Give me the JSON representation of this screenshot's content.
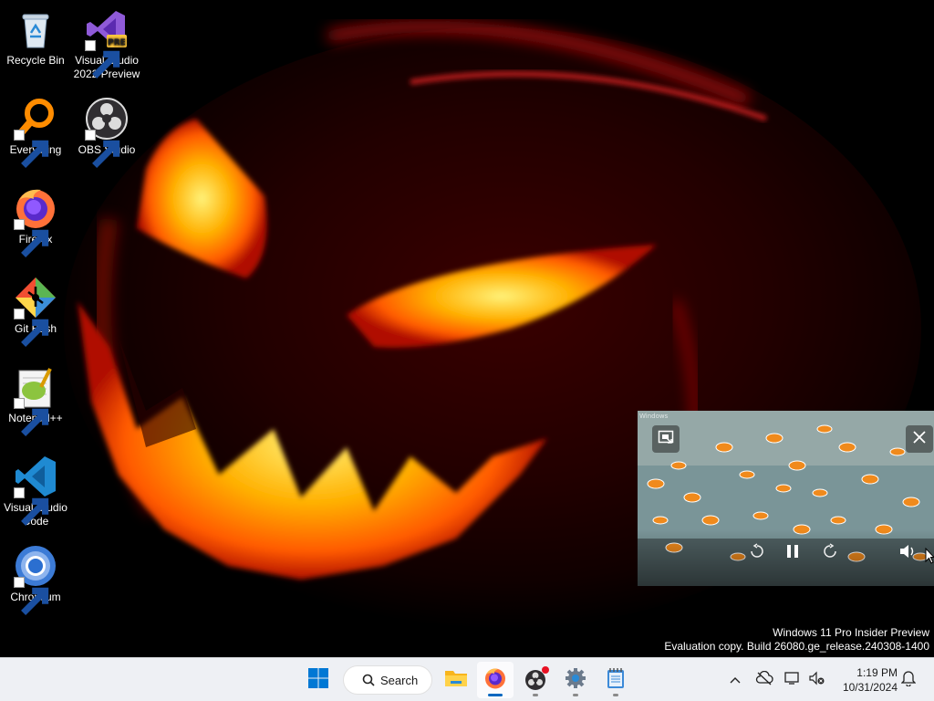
{
  "desktop": {
    "icons": [
      {
        "label": "Recycle Bin",
        "icon": "recycle-bin-icon",
        "shortcut": false
      },
      {
        "label": "Visual Studio 2022 Preview",
        "icon": "visual-studio-preview-icon",
        "shortcut": true,
        "badge": "PRE"
      },
      {
        "label": "Everything",
        "icon": "everything-search-icon",
        "shortcut": true
      },
      {
        "label": "OBS Studio",
        "icon": "obs-studio-icon",
        "shortcut": true
      },
      {
        "label": "Firefox",
        "icon": "firefox-icon",
        "shortcut": true
      },
      {
        "label": "Git Bash",
        "icon": "git-bash-icon",
        "shortcut": true
      },
      {
        "label": "Notepad++",
        "icon": "notepad-plus-plus-icon",
        "shortcut": true
      },
      {
        "label": "Visual Studio Code",
        "icon": "vscode-icon",
        "shortcut": true
      },
      {
        "label": "Chromium",
        "icon": "chromium-icon",
        "shortcut": true
      }
    ]
  },
  "watermark": {
    "line1": "Windows 11 Pro Insider Preview",
    "line2": "Evaluation copy. Build 26080.ge_release.240308-1400"
  },
  "pip_player": {
    "source_tag": "Windows",
    "controls": [
      "back-to-tab-icon",
      "close-icon",
      "rewind-10-icon",
      "pause-icon",
      "forward-10-icon",
      "volume-icon"
    ]
  },
  "taskbar": {
    "start_icon": "windows-start-icon",
    "search_label": "Search",
    "pinned": [
      {
        "name": "file-explorer",
        "icon": "folder-icon",
        "running": false,
        "active": false
      },
      {
        "name": "firefox",
        "icon": "firefox-icon",
        "running": true,
        "active": true
      },
      {
        "name": "obs-studio",
        "icon": "obs-studio-icon",
        "running": true,
        "active": false
      },
      {
        "name": "settings",
        "icon": "gear-icon",
        "running": true,
        "active": false
      },
      {
        "name": "notepad",
        "icon": "notepad-icon",
        "running": true,
        "active": false
      }
    ],
    "tray": [
      "chevron-up-icon",
      "cloud-offline-icon",
      "network-icon",
      "volume-muted-icon"
    ],
    "clock": {
      "time": "1:19 PM",
      "date": "10/31/2024"
    },
    "notification_icon": "bell-icon"
  },
  "colors": {
    "taskbar_bg": "#eef0f4",
    "accent": "#0067c0",
    "pumpkin_glow": "#ff9a1a"
  }
}
